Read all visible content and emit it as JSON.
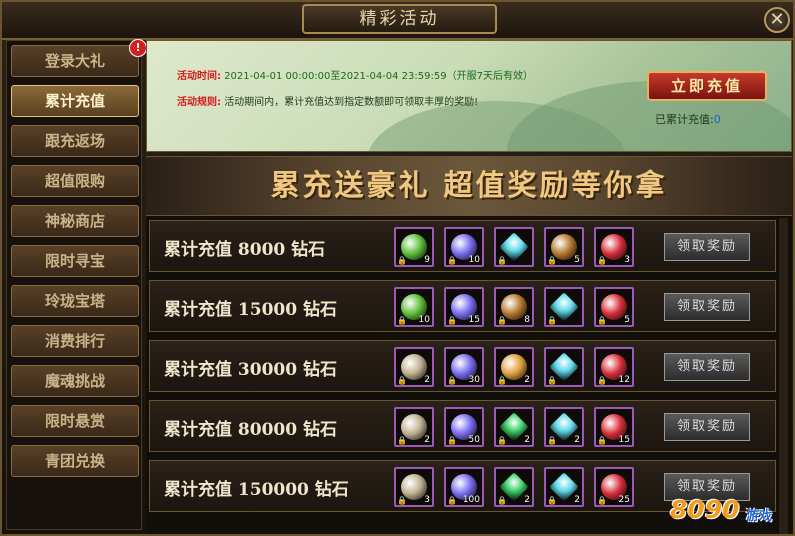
{
  "window": {
    "title": "精彩活动",
    "close": "✕"
  },
  "sidebar": {
    "alert": "!",
    "items": [
      {
        "label": "登录大礼"
      },
      {
        "label": "累计充值",
        "active": true
      },
      {
        "label": "跟充返场"
      },
      {
        "label": "超值限购"
      },
      {
        "label": "神秘商店"
      },
      {
        "label": "限时寻宝"
      },
      {
        "label": "玲珑宝塔"
      },
      {
        "label": "消费排行"
      },
      {
        "label": "魔魂挑战"
      },
      {
        "label": "限时悬赏"
      },
      {
        "label": "青团兑换"
      }
    ]
  },
  "banner": {
    "time_label": "活动时间:",
    "time_value": "2021-04-01 00:00:00至2021-04-04 23:59:59（开服7天后有效）",
    "rule_label": "活动规则:",
    "rule_value": "活动期间内，累计充值达到指定数额即可领取丰厚的奖励!",
    "recharge_button": "立即充值",
    "accum_label": "已累计充值:",
    "accum_value": "0"
  },
  "slogan": "累充送豪礼   超值奖励等你拿",
  "tiers": [
    {
      "label": "累计充值  8000  钻石",
      "claim": "领取奖励",
      "items": [
        {
          "icon": "green-leaf-icon",
          "color": "#5fbf3a",
          "count": "9"
        },
        {
          "icon": "purple-feather-icon",
          "color": "#7a6cf0",
          "count": "10"
        },
        {
          "icon": "cyan-crystal-icon",
          "color": "#5fd8e8",
          "count": ""
        },
        {
          "icon": "bronze-amulet-icon",
          "color": "#b5782e",
          "count": "5"
        },
        {
          "icon": "red-gem-emblem-icon",
          "color": "#d8303a",
          "count": "3"
        }
      ]
    },
    {
      "label": "累计充值  15000  钻石",
      "claim": "领取奖励",
      "items": [
        {
          "icon": "green-leaf-icon",
          "color": "#5fbf3a",
          "count": "10"
        },
        {
          "icon": "purple-feather-icon",
          "color": "#7a6cf0",
          "count": "15"
        },
        {
          "icon": "bronze-amulet-icon",
          "color": "#b5782e",
          "count": "8"
        },
        {
          "icon": "cyan-crystal-icon",
          "color": "#5fd8e8",
          "count": ""
        },
        {
          "icon": "red-gem-emblem-icon",
          "color": "#d8303a",
          "count": "5"
        }
      ]
    },
    {
      "label": "累计充值  30000  钻石",
      "claim": "领取奖励",
      "items": [
        {
          "icon": "compass-disc-icon",
          "color": "#c0b090",
          "count": "2"
        },
        {
          "icon": "purple-feather-icon",
          "color": "#7a6cf0",
          "count": "30"
        },
        {
          "icon": "rainbow-orb-icon",
          "color": "#e0a040",
          "count": "2"
        },
        {
          "icon": "cyan-crystal-icon",
          "color": "#5fd8e8",
          "count": ""
        },
        {
          "icon": "red-gem-emblem-icon",
          "color": "#d8303a",
          "count": "12"
        }
      ]
    },
    {
      "label": "累计充值  80000  钻石",
      "claim": "领取奖励",
      "items": [
        {
          "icon": "compass-disc-icon",
          "color": "#c0b090",
          "count": "2"
        },
        {
          "icon": "purple-feather-icon",
          "color": "#7a6cf0",
          "count": "50"
        },
        {
          "icon": "green-crystal-icon",
          "color": "#3ed06a",
          "count": "2"
        },
        {
          "icon": "cyan-crystal-icon",
          "color": "#5fd8e8",
          "count": "2"
        },
        {
          "icon": "red-gem-emblem-icon",
          "color": "#d8303a",
          "count": "15"
        }
      ]
    },
    {
      "label": "累计充值  150000  钻石",
      "claim": "领取奖励",
      "items": [
        {
          "icon": "compass-disc-icon",
          "color": "#c0b090",
          "count": "3"
        },
        {
          "icon": "purple-feather-icon",
          "color": "#7a6cf0",
          "count": "100"
        },
        {
          "icon": "green-crystal-icon",
          "color": "#3ed06a",
          "count": "2"
        },
        {
          "icon": "cyan-crystal-icon",
          "color": "#5fd8e8",
          "count": "2"
        },
        {
          "icon": "red-gem-emblem-icon",
          "color": "#d8303a",
          "count": "25"
        }
      ]
    }
  ],
  "watermark": {
    "num": "8090",
    "text": "游戏"
  }
}
